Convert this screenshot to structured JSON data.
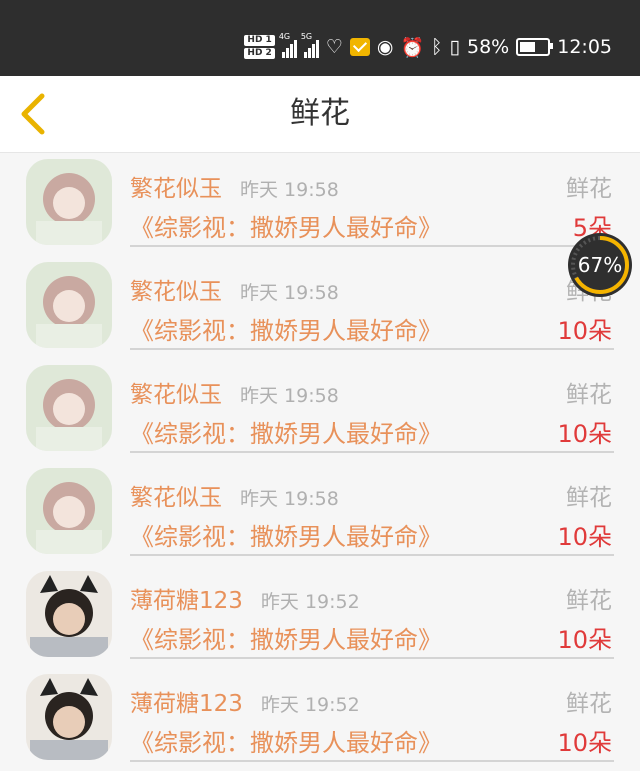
{
  "status_bar": {
    "hd1": "HD 1",
    "hd2": "HD 2",
    "net1": "4G",
    "net2": "5G",
    "battery_pct": "58%",
    "time": "12:05"
  },
  "header": {
    "title": "鲜花"
  },
  "items": [
    {
      "name": "繁花似玉",
      "time": "昨天 19:58",
      "type": "鲜花",
      "book": "《综影视：撒娇男人最好命》",
      "count": "5朵"
    },
    {
      "name": "繁花似玉",
      "time": "昨天 19:58",
      "type": "鲜花",
      "book": "《综影视：撒娇男人最好命》",
      "count": "10朵"
    },
    {
      "name": "繁花似玉",
      "time": "昨天 19:58",
      "type": "鲜花",
      "book": "《综影视：撒娇男人最好命》",
      "count": "10朵"
    },
    {
      "name": "繁花似玉",
      "time": "昨天 19:58",
      "type": "鲜花",
      "book": "《综影视：撒娇男人最好命》",
      "count": "10朵"
    },
    {
      "name": "薄荷糖123",
      "time": "昨天 19:52",
      "type": "鲜花",
      "book": "《综影视：撒娇男人最好命》",
      "count": "10朵"
    },
    {
      "name": "薄荷糖123",
      "time": "昨天 19:52",
      "type": "鲜花",
      "book": "《综影视：撒娇男人最好命》",
      "count": "10朵"
    }
  ],
  "floating_widget": {
    "label": "67%",
    "progress": 0.67
  },
  "colors": {
    "accent": "#e8915a",
    "count": "#e03a3a",
    "back_arrow": "#e9b300"
  }
}
